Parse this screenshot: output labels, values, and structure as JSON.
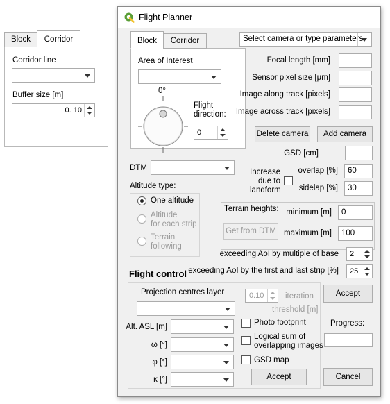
{
  "corridor_panel": {
    "tabs": [
      "Block",
      "Corridor"
    ],
    "active_tab": "Corridor",
    "corridor_line_label": "Corridor line",
    "corridor_line_value": "",
    "buffer_size_label": "Buffer size [m]",
    "buffer_size_value": "0. 10"
  },
  "window": {
    "title": "Flight Planner",
    "icon": "qgis-logo-icon",
    "accent_green": "#5a9e37"
  },
  "aoi_panel": {
    "tabs": [
      "Block",
      "Corridor"
    ],
    "active_tab": "Block",
    "area_of_interest_label": "Area of Interest",
    "area_of_interest_value": "",
    "dial_degree_label": "0°",
    "flight_direction_label_line1": "Flight",
    "flight_direction_label_line2": "direction:",
    "flight_direction_value": "0"
  },
  "camera": {
    "select_placeholder": "Select camera or type parameters",
    "focal_length_label": "Focal length [mm]",
    "sensor_pixel_size_label": "Sensor pixel size [µm]",
    "image_along_track_label": "Image along track [pixels]",
    "image_across_track_label": "Image across track [pixels]",
    "delete_camera_label": "Delete camera",
    "add_camera_label": "Add camera"
  },
  "gsd": {
    "gsd_label": "GSD [cm]",
    "overlap_label": "overlap [%]",
    "overlap_value": "60",
    "sidelap_label": "sidelap [%]",
    "sidelap_value": "30",
    "increase_label_line1": "Increase",
    "increase_label_line2": "due to",
    "increase_label_line3": "landform"
  },
  "dtm": {
    "dtm_label": "DTM",
    "dtm_value": ""
  },
  "altitude": {
    "altitude_type_label": "Altitude type:",
    "one_altitude_label": "One altitude",
    "each_strip_label_line1": "Altitude",
    "each_strip_label_line2": "for each strip",
    "terrain_following_line1": "Terrain",
    "terrain_following_line2": "following"
  },
  "terrain": {
    "terrain_heights_label": "Terrain heights:",
    "get_from_dtm_label": "Get from DTM",
    "minimum_label": "minimum [m]",
    "minimum_value": "0",
    "maximum_label": "maximum [m]",
    "maximum_value": "100"
  },
  "exceeding": {
    "multiple_of_base_label": "exceeding AoI by multiple of base",
    "multiple_of_base_value": "2",
    "first_last_strip_label": "exceeding AoI by the first and last strip [%]",
    "first_last_strip_value": "25"
  },
  "flight_control": {
    "title": "Flight control",
    "projection_centres_label": "Projection centres layer",
    "projection_centres_value": "",
    "iteration_value": "0.10",
    "iteration_label_line1": "iteration",
    "iteration_label_line2": "threshold [m]",
    "alt_asl_label": "Alt. ASL [m]",
    "omega_label": "ω [°]",
    "phi_label": "φ [°]",
    "kappa_label": "κ [°]",
    "photo_footprint_label": "Photo footprint",
    "logical_sum_line1": "Logical sum of",
    "logical_sum_line2": "overlapping images",
    "gsd_map_label": "GSD map",
    "accept_inner_label": "Accept"
  },
  "actions": {
    "accept_label": "Accept",
    "progress_label": "Progress:",
    "progress_value": "",
    "cancel_label": "Cancel"
  }
}
